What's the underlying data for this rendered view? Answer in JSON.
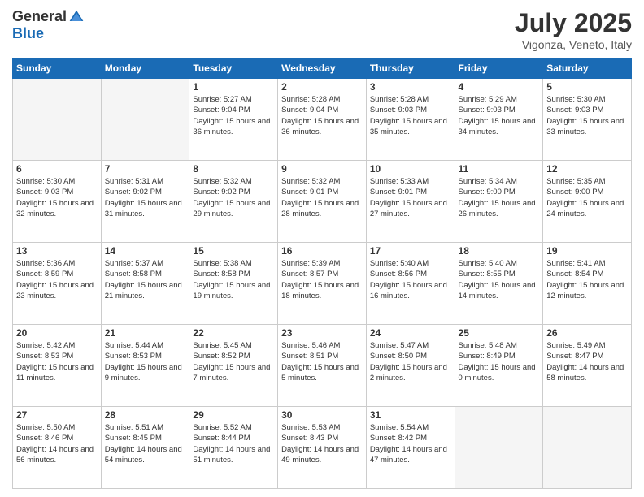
{
  "header": {
    "logo_general": "General",
    "logo_blue": "Blue",
    "month_title": "July 2025",
    "location": "Vigonza, Veneto, Italy"
  },
  "weekdays": [
    "Sunday",
    "Monday",
    "Tuesday",
    "Wednesday",
    "Thursday",
    "Friday",
    "Saturday"
  ],
  "weeks": [
    [
      {
        "day": "",
        "info": ""
      },
      {
        "day": "",
        "info": ""
      },
      {
        "day": "1",
        "info": "Sunrise: 5:27 AM\nSunset: 9:04 PM\nDaylight: 15 hours and 36 minutes."
      },
      {
        "day": "2",
        "info": "Sunrise: 5:28 AM\nSunset: 9:04 PM\nDaylight: 15 hours and 36 minutes."
      },
      {
        "day": "3",
        "info": "Sunrise: 5:28 AM\nSunset: 9:03 PM\nDaylight: 15 hours and 35 minutes."
      },
      {
        "day": "4",
        "info": "Sunrise: 5:29 AM\nSunset: 9:03 PM\nDaylight: 15 hours and 34 minutes."
      },
      {
        "day": "5",
        "info": "Sunrise: 5:30 AM\nSunset: 9:03 PM\nDaylight: 15 hours and 33 minutes."
      }
    ],
    [
      {
        "day": "6",
        "info": "Sunrise: 5:30 AM\nSunset: 9:03 PM\nDaylight: 15 hours and 32 minutes."
      },
      {
        "day": "7",
        "info": "Sunrise: 5:31 AM\nSunset: 9:02 PM\nDaylight: 15 hours and 31 minutes."
      },
      {
        "day": "8",
        "info": "Sunrise: 5:32 AM\nSunset: 9:02 PM\nDaylight: 15 hours and 29 minutes."
      },
      {
        "day": "9",
        "info": "Sunrise: 5:32 AM\nSunset: 9:01 PM\nDaylight: 15 hours and 28 minutes."
      },
      {
        "day": "10",
        "info": "Sunrise: 5:33 AM\nSunset: 9:01 PM\nDaylight: 15 hours and 27 minutes."
      },
      {
        "day": "11",
        "info": "Sunrise: 5:34 AM\nSunset: 9:00 PM\nDaylight: 15 hours and 26 minutes."
      },
      {
        "day": "12",
        "info": "Sunrise: 5:35 AM\nSunset: 9:00 PM\nDaylight: 15 hours and 24 minutes."
      }
    ],
    [
      {
        "day": "13",
        "info": "Sunrise: 5:36 AM\nSunset: 8:59 PM\nDaylight: 15 hours and 23 minutes."
      },
      {
        "day": "14",
        "info": "Sunrise: 5:37 AM\nSunset: 8:58 PM\nDaylight: 15 hours and 21 minutes."
      },
      {
        "day": "15",
        "info": "Sunrise: 5:38 AM\nSunset: 8:58 PM\nDaylight: 15 hours and 19 minutes."
      },
      {
        "day": "16",
        "info": "Sunrise: 5:39 AM\nSunset: 8:57 PM\nDaylight: 15 hours and 18 minutes."
      },
      {
        "day": "17",
        "info": "Sunrise: 5:40 AM\nSunset: 8:56 PM\nDaylight: 15 hours and 16 minutes."
      },
      {
        "day": "18",
        "info": "Sunrise: 5:40 AM\nSunset: 8:55 PM\nDaylight: 15 hours and 14 minutes."
      },
      {
        "day": "19",
        "info": "Sunrise: 5:41 AM\nSunset: 8:54 PM\nDaylight: 15 hours and 12 minutes."
      }
    ],
    [
      {
        "day": "20",
        "info": "Sunrise: 5:42 AM\nSunset: 8:53 PM\nDaylight: 15 hours and 11 minutes."
      },
      {
        "day": "21",
        "info": "Sunrise: 5:44 AM\nSunset: 8:53 PM\nDaylight: 15 hours and 9 minutes."
      },
      {
        "day": "22",
        "info": "Sunrise: 5:45 AM\nSunset: 8:52 PM\nDaylight: 15 hours and 7 minutes."
      },
      {
        "day": "23",
        "info": "Sunrise: 5:46 AM\nSunset: 8:51 PM\nDaylight: 15 hours and 5 minutes."
      },
      {
        "day": "24",
        "info": "Sunrise: 5:47 AM\nSunset: 8:50 PM\nDaylight: 15 hours and 2 minutes."
      },
      {
        "day": "25",
        "info": "Sunrise: 5:48 AM\nSunset: 8:49 PM\nDaylight: 15 hours and 0 minutes."
      },
      {
        "day": "26",
        "info": "Sunrise: 5:49 AM\nSunset: 8:47 PM\nDaylight: 14 hours and 58 minutes."
      }
    ],
    [
      {
        "day": "27",
        "info": "Sunrise: 5:50 AM\nSunset: 8:46 PM\nDaylight: 14 hours and 56 minutes."
      },
      {
        "day": "28",
        "info": "Sunrise: 5:51 AM\nSunset: 8:45 PM\nDaylight: 14 hours and 54 minutes."
      },
      {
        "day": "29",
        "info": "Sunrise: 5:52 AM\nSunset: 8:44 PM\nDaylight: 14 hours and 51 minutes."
      },
      {
        "day": "30",
        "info": "Sunrise: 5:53 AM\nSunset: 8:43 PM\nDaylight: 14 hours and 49 minutes."
      },
      {
        "day": "31",
        "info": "Sunrise: 5:54 AM\nSunset: 8:42 PM\nDaylight: 14 hours and 47 minutes."
      },
      {
        "day": "",
        "info": ""
      },
      {
        "day": "",
        "info": ""
      }
    ]
  ]
}
